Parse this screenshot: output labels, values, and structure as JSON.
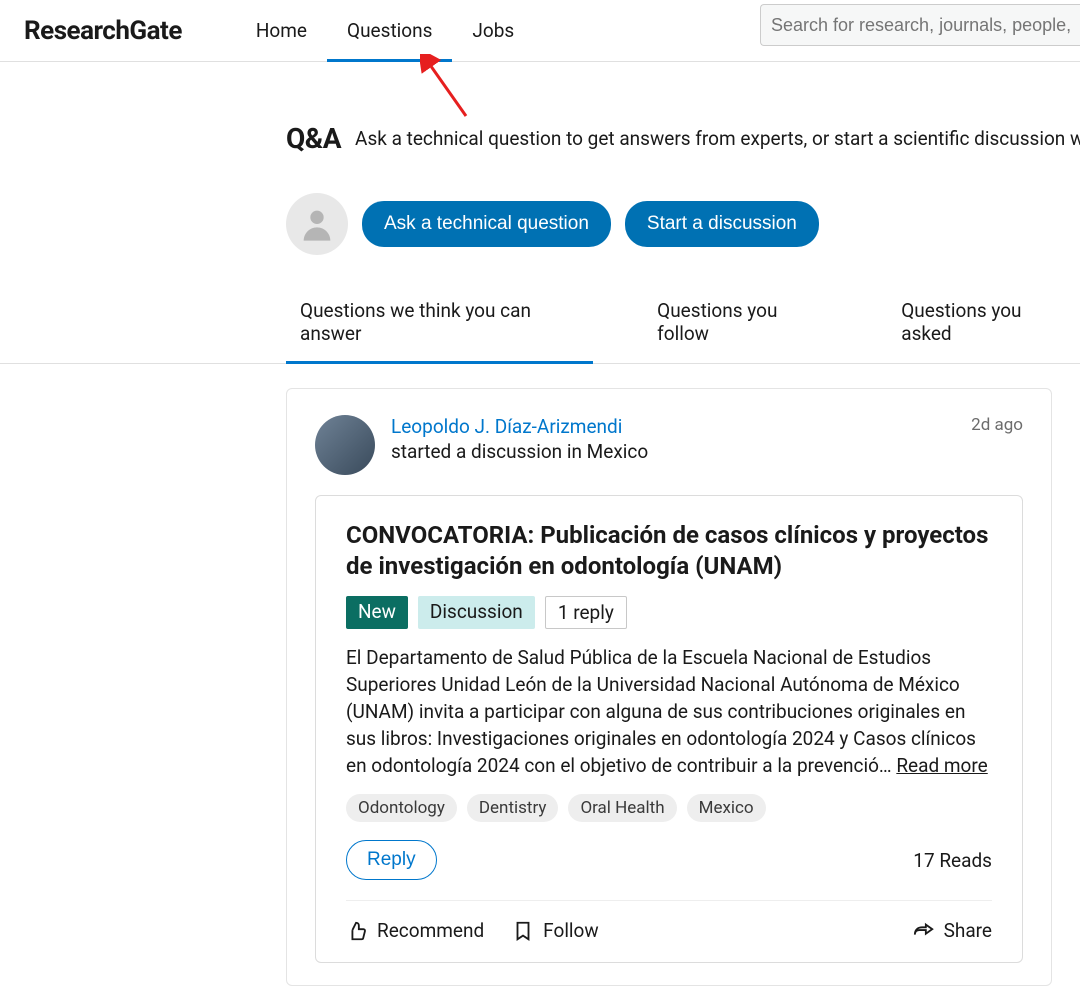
{
  "header": {
    "logo": "ResearchGate",
    "nav": [
      "Home",
      "Questions",
      "Jobs"
    ],
    "active_nav_index": 1,
    "search_placeholder": "Search for research, journals, people,"
  },
  "qa": {
    "title": "Q&A",
    "subtitle": "Ask a technical question to get answers from experts, or start a scientific discussion w",
    "ask_btn": "Ask a technical question",
    "start_btn": "Start a discussion"
  },
  "filters": {
    "tabs": [
      "Questions we think you can answer",
      "Questions you follow",
      "Questions you asked"
    ],
    "active_index": 0
  },
  "post": {
    "author": "Leopoldo J. Díaz-Arizmendi",
    "action_line": "started a discussion in Mexico",
    "timestamp": "2d ago",
    "title": "CONVOCATORIA: Publicación de casos clínicos y proyectos de investigación en odontología (UNAM)",
    "badges": {
      "new": "New",
      "discussion": "Discussion",
      "replies": "1 reply"
    },
    "body": "El Departamento de Salud Pública de la Escuela Nacional de Estudios Superiores Unidad León de la Universidad Nacional Autónoma de México (UNAM) invita a participar con alguna de sus contribuciones originales en sus libros: Investigaciones originales en odontología 2024 y Casos clínicos en odontología 2024 con el objetivo de contribuir a la prevenció… ",
    "read_more": "Read more",
    "tags": [
      "Odontology",
      "Dentistry",
      "Oral Health",
      "Mexico"
    ],
    "reply_btn": "Reply",
    "reads": "17 Reads",
    "actions": {
      "recommend": "Recommend",
      "follow": "Follow",
      "share": "Share"
    }
  }
}
